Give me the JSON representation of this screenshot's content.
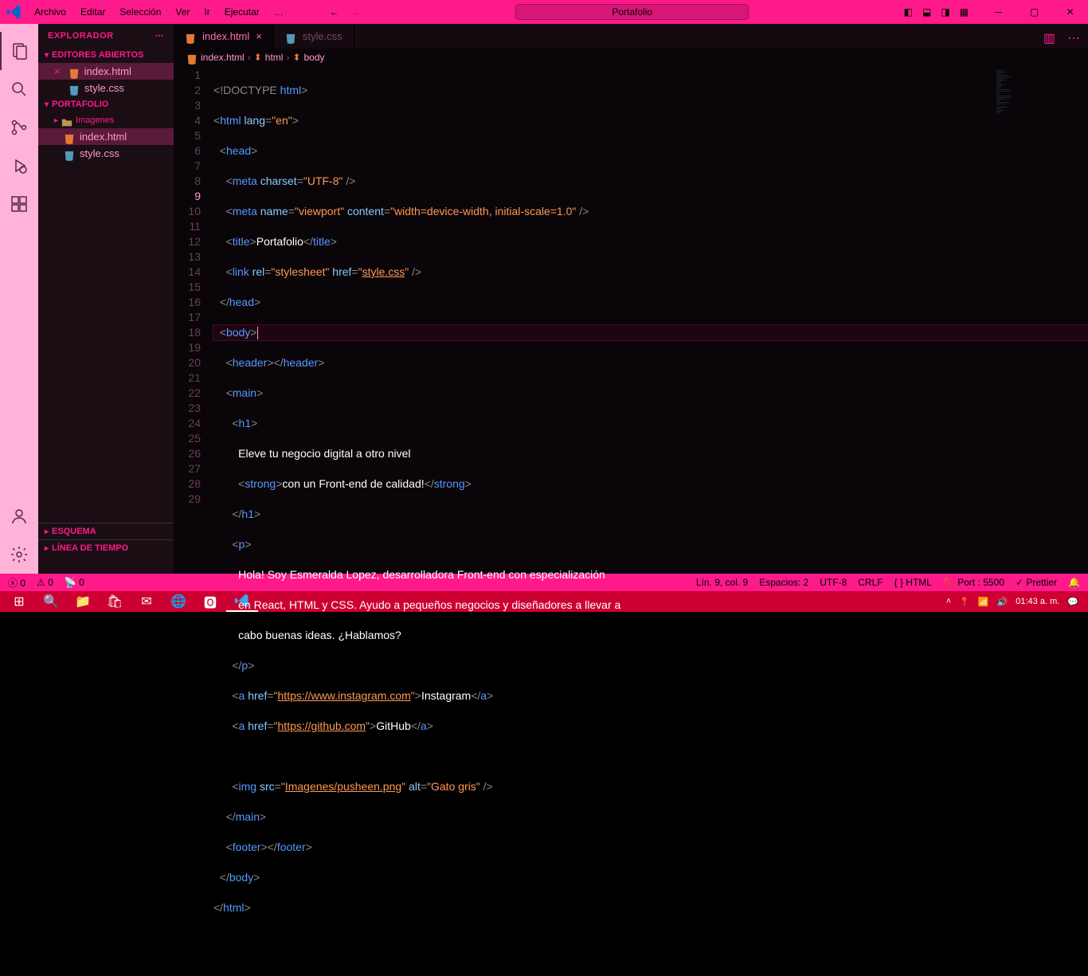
{
  "titlebar": {
    "menu": [
      "Archivo",
      "Editar",
      "Selección",
      "Ver",
      "Ir",
      "Ejecutar",
      "…"
    ],
    "title": "Portafolio"
  },
  "sidebar": {
    "title": "EXPLORADOR",
    "open_editors": "EDITORES ABIERTOS",
    "project": "PORTAFOLIO",
    "outline": "ESQUEMA",
    "timeline": "LÍNEA DE TIEMPO",
    "open_files": [
      {
        "name": "index.html",
        "active": true,
        "close": "×"
      },
      {
        "name": "style.css",
        "active": false
      }
    ],
    "tree": {
      "folder": "Imagenes",
      "files": [
        "index.html",
        "style.css"
      ]
    }
  },
  "tabs": [
    {
      "name": "index.html",
      "active": true,
      "icon": "html"
    },
    {
      "name": "style.css",
      "active": false,
      "icon": "css"
    }
  ],
  "breadcrumb": [
    "index.html",
    "html",
    "body"
  ],
  "code": {
    "lines": 29,
    "current": 9
  },
  "statusbar": {
    "errors": "0",
    "warnings": "0",
    "radio": "0",
    "pos": "Lín. 9, col. 9",
    "spaces": "Espacios: 2",
    "encoding": "UTF-8",
    "eol": "CRLF",
    "lang": "HTML",
    "port": "Port : 5500",
    "prettier": "Prettier"
  },
  "taskbar": {
    "time": "01:43 a. m."
  },
  "code_text": {
    "l1_doc": "!DOCTYPE",
    "l1_html": " html",
    "l2_tag": "html",
    "l2_attr": " lang",
    "l2_val": "\"en\"",
    "l3": "head",
    "l4_tag": "meta",
    "l4_attr": " charset",
    "l4_val": "\"UTF-8\"",
    "l5_tag": "meta",
    "l5_a1": " name",
    "l5_v1": "\"viewport\"",
    "l5_a2": " content",
    "l5_v2": "\"width=device-width, initial-scale=1.0\"",
    "l6_tag": "title",
    "l6_text": "Portafolio",
    "l7_tag": "link",
    "l7_a1": " rel",
    "l7_v1": "\"stylesheet\"",
    "l7_a2": " href",
    "l7_v2": "\"style.css\"",
    "l8": "head",
    "l9": "body",
    "l10": "header",
    "l11": "main",
    "l12": "h1",
    "l13": "Eleve tu negocio digital a otro nivel",
    "l14_tag": "strong",
    "l14_text": "con un Front-end de calidad!",
    "l15": "h1",
    "l16": "p",
    "l17": "Hola! Soy Esmeralda Lopez, desarrolladora Front-end con especialización",
    "l18": "en React, HTML y CSS. Ayudo a pequeños negocios y diseñadores a llevar a",
    "l19": "cabo buenas ideas. ¿Hablamos?",
    "l20": "p",
    "l21_tag": "a",
    "l21_attr": " href",
    "l21_val": "\"https://www.instagram.com\"",
    "l21_text": "Instagram",
    "l22_tag": "a",
    "l22_attr": " href",
    "l22_val": "\"https://github.com\"",
    "l22_text": "GitHub",
    "l24_tag": "img",
    "l24_a1": " src",
    "l24_v1": "\"Imagenes/pusheen.png\"",
    "l24_a2": " alt",
    "l24_v2": "\"Gato gris\"",
    "l25": "main",
    "l26": "footer",
    "l27": "body",
    "l28": "html"
  }
}
